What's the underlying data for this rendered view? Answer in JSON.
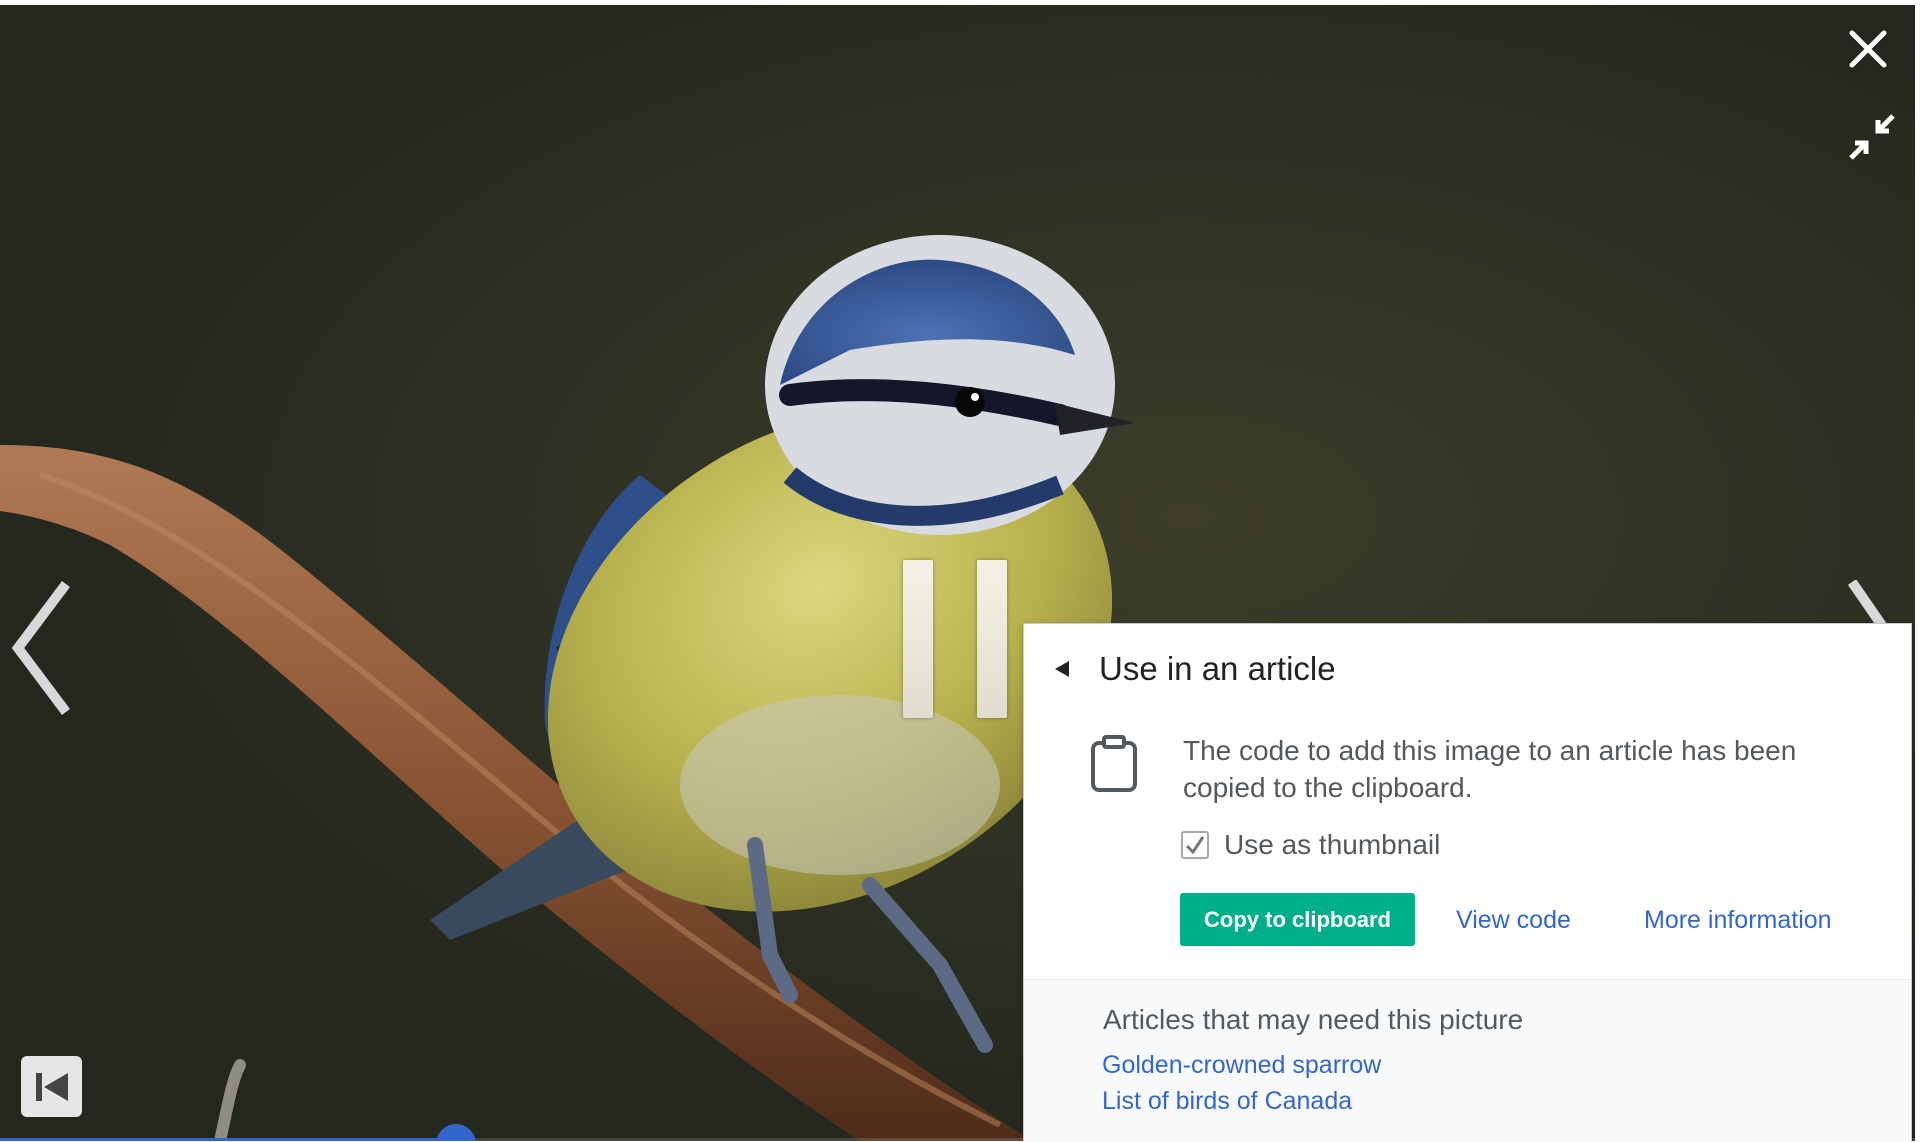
{
  "viewer": {
    "close_icon": "close-icon",
    "shrink_icon": "exit-fullscreen-icon",
    "prev_icon": "chevron-left-icon",
    "next_icon": "chevron-right-icon",
    "pause_icon": "pause-icon",
    "skip_icon": "skip-to-start-icon",
    "progress_fraction": 0.238,
    "accent_color": "#3366cc"
  },
  "panel": {
    "collapse_icon": "triangle-left-icon",
    "title": "Use in an article",
    "clipboard_icon": "clipboard-icon",
    "message": "The code to add this image to an article has been copied to the clipboard.",
    "thumbnail_label": "Use as thumbnail",
    "thumbnail_checked": true,
    "copy_button": "Copy to clipboard",
    "copy_button_color": "#00af89",
    "view_code_link": "View code",
    "more_info_link": "More information",
    "articles_heading": "Articles that may need this picture",
    "articles": [
      "Golden-crowned sparrow",
      "List of birds of Canada"
    ]
  }
}
